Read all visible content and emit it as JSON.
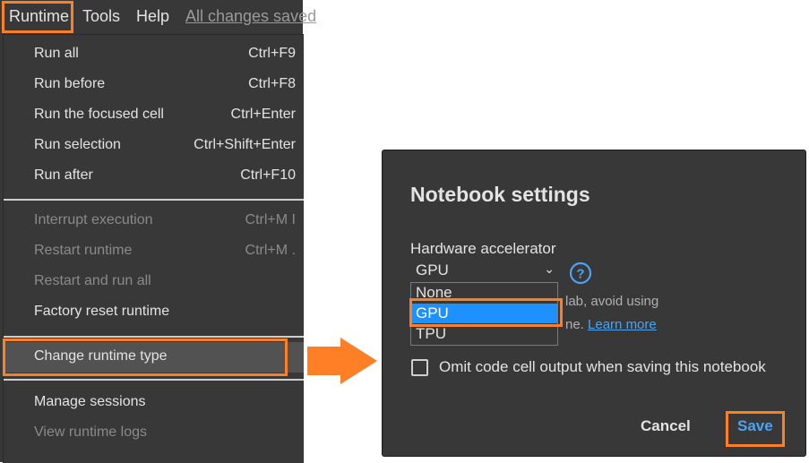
{
  "menubar": {
    "items": [
      "Runtime",
      "Tools",
      "Help"
    ],
    "save_status": "All changes saved"
  },
  "runtime_menu": {
    "items": [
      {
        "label": "Run all",
        "shortcut": "Ctrl+F9",
        "enabled": true
      },
      {
        "label": "Run before",
        "shortcut": "Ctrl+F8",
        "enabled": true
      },
      {
        "label": "Run the focused cell",
        "shortcut": "Ctrl+Enter",
        "enabled": true
      },
      {
        "label": "Run selection",
        "shortcut": "Ctrl+Shift+Enter",
        "enabled": true
      },
      {
        "label": "Run after",
        "shortcut": "Ctrl+F10",
        "enabled": true
      },
      {
        "label": "Interrupt execution",
        "shortcut": "Ctrl+M I",
        "enabled": false
      },
      {
        "label": "Restart runtime",
        "shortcut": "Ctrl+M .",
        "enabled": false
      },
      {
        "label": "Restart and run all",
        "shortcut": "",
        "enabled": false
      },
      {
        "label": "Factory reset runtime",
        "shortcut": "",
        "enabled": true
      },
      {
        "label": "Change runtime type",
        "shortcut": "",
        "enabled": true,
        "highlighted": true
      },
      {
        "label": "Manage sessions",
        "shortcut": "",
        "enabled": true
      },
      {
        "label": "View runtime logs",
        "shortcut": "",
        "enabled": false
      }
    ]
  },
  "dialog": {
    "title": "Notebook settings",
    "hardware_label": "Hardware accelerator",
    "selected_value": "GPU",
    "options": [
      "None",
      "GPU",
      "TPU"
    ],
    "note_line1": "lab, avoid using",
    "note_line2": "ne.",
    "learn_more": "Learn more",
    "omit_output_label": "Omit code cell output when saving this notebook",
    "omit_output_checked": false,
    "cancel_label": "Cancel",
    "save_label": "Save"
  },
  "colors": {
    "highlight": "#ff7f27",
    "accent": "#4ea3f0",
    "selected_option": "#1e90ff",
    "panel_bg": "#383838"
  }
}
